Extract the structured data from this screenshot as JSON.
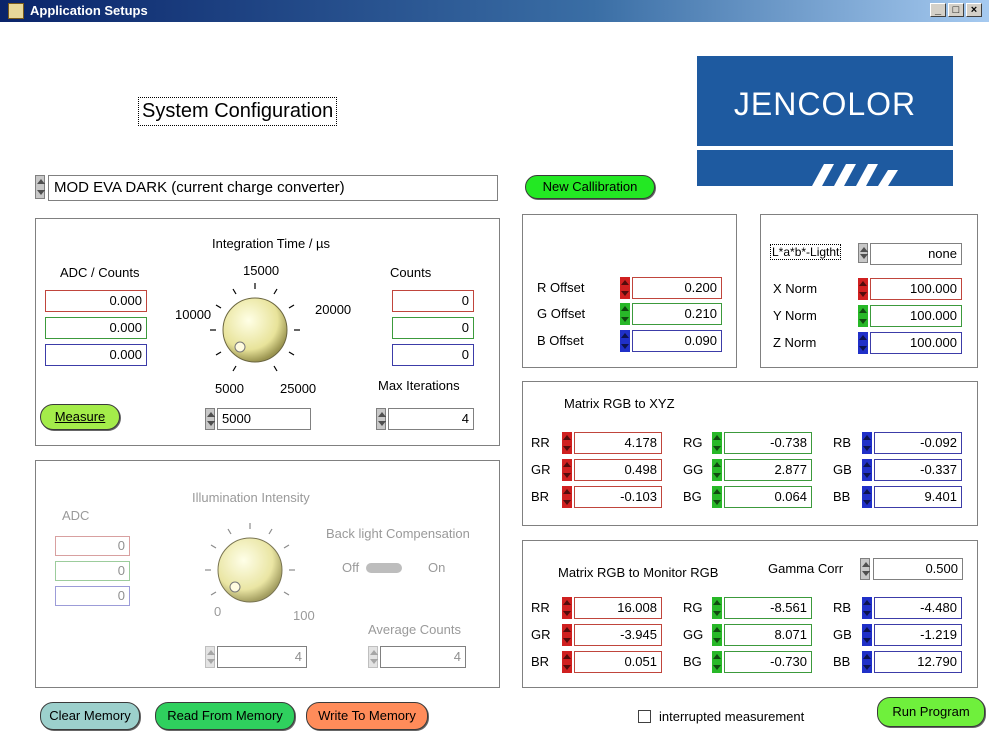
{
  "window": {
    "title": "Application Setups",
    "min": "_",
    "max": "□",
    "close": "×"
  },
  "header": {
    "config_title": "System Configuration",
    "logo_text": "JENCOLOR"
  },
  "device": {
    "selected": "MOD EVA DARK (current charge converter)"
  },
  "new_calibration_label": "New Callibration",
  "measure_panel": {
    "adc_label": "ADC / Counts",
    "adc_values": [
      "0.000",
      "0.000",
      "0.000"
    ],
    "integration_label": "Integration Time / µs",
    "knob_ticks": [
      "15000",
      "10000",
      "20000",
      "5000",
      "25000"
    ],
    "integration_value": "5000",
    "counts_label": "Counts",
    "counts_values": [
      "0",
      "0",
      "0"
    ],
    "max_iter_label": "Max Iterations",
    "max_iter_value": "4",
    "measure_button": "Measure"
  },
  "illum_panel": {
    "adc_label": "ADC",
    "adc_values": [
      "0",
      "0",
      "0"
    ],
    "illum_label": "Illumination Intensity",
    "knob_min": "0",
    "knob_max": "100",
    "backlight_label": "Back light Compensation",
    "off": "Off",
    "on": "On",
    "illum_value": "4",
    "avg_label": "Average Counts",
    "avg_value": "4"
  },
  "offsets": {
    "r_label": "R Offset",
    "r_value": "0.200",
    "g_label": "G Offset",
    "g_value": "0.210",
    "b_label": "B Offset",
    "b_value": "0.090"
  },
  "lab_panel": {
    "mode": "L*a*b*-Ligtht",
    "mode_value": "none",
    "x_label": "X Norm",
    "x_value": "100.000",
    "y_label": "Y Norm",
    "y_value": "100.000",
    "z_label": "Z Norm",
    "z_value": "100.000"
  },
  "matrix_xyz": {
    "title": "Matrix RGB to XYZ",
    "rows": [
      [
        {
          "k": "RR",
          "v": "4.178"
        },
        {
          "k": "RG",
          "v": "-0.738"
        },
        {
          "k": "RB",
          "v": "-0.092"
        }
      ],
      [
        {
          "k": "GR",
          "v": "0.498"
        },
        {
          "k": "GG",
          "v": "2.877"
        },
        {
          "k": "GB",
          "v": "-0.337"
        }
      ],
      [
        {
          "k": "BR",
          "v": "-0.103"
        },
        {
          "k": "BG",
          "v": "0.064"
        },
        {
          "k": "BB",
          "v": "9.401"
        }
      ]
    ]
  },
  "matrix_monitor": {
    "title": "Matrix RGB to Monitor RGB",
    "gamma_label": "Gamma Corr",
    "gamma_value": "0.500",
    "rows": [
      [
        {
          "k": "RR",
          "v": "16.008"
        },
        {
          "k": "RG",
          "v": "-8.561"
        },
        {
          "k": "RB",
          "v": "-4.480"
        }
      ],
      [
        {
          "k": "GR",
          "v": "-3.945"
        },
        {
          "k": "GG",
          "v": "8.071"
        },
        {
          "k": "GB",
          "v": "-1.219"
        }
      ],
      [
        {
          "k": "BR",
          "v": "0.051"
        },
        {
          "k": "BG",
          "v": "-0.730"
        },
        {
          "k": "BB",
          "v": "12.790"
        }
      ]
    ]
  },
  "footer": {
    "clear": "Clear Memory",
    "read": "Read From  Memory",
    "write": "Write To Memory",
    "interrupted": "interrupted measurement",
    "run": "Run Program"
  },
  "colors": {
    "red": "#d02020",
    "green": "#28b828",
    "blue": "#2030c8",
    "logo_blue": "#1e5aa0"
  }
}
